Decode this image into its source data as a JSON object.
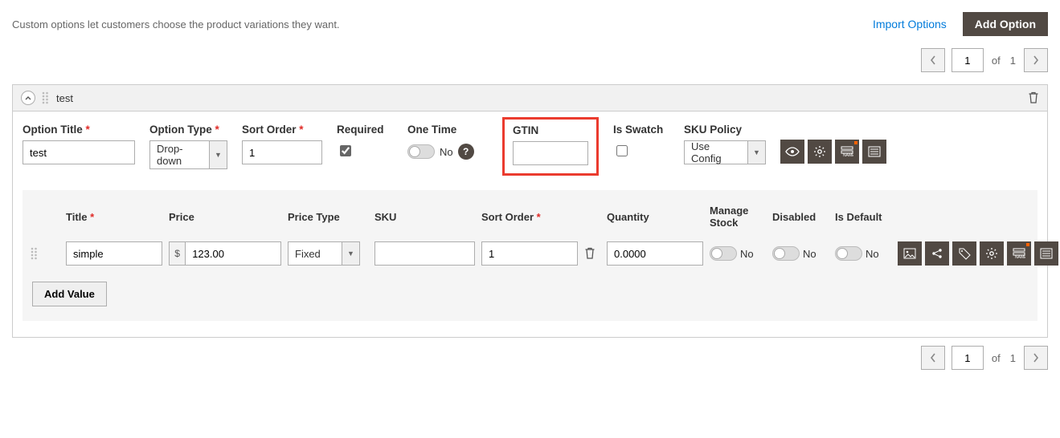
{
  "description": "Custom options let customers choose the product variations they want.",
  "top_buttons": {
    "import": "Import Options",
    "add": "Add Option"
  },
  "pager": {
    "current": "1",
    "of_text": "of",
    "total": "1"
  },
  "option": {
    "header_title": "test",
    "fields": {
      "option_title": {
        "label": "Option Title",
        "value": "test"
      },
      "option_type": {
        "label": "Option Type",
        "value": "Drop-down"
      },
      "sort_order": {
        "label": "Sort Order",
        "value": "1"
      },
      "required": {
        "label": "Required",
        "checked": true
      },
      "one_time": {
        "label": "One Time",
        "value_text": "No"
      },
      "gtin": {
        "label": "GTIN",
        "value": ""
      },
      "is_swatch": {
        "label": "Is Swatch",
        "checked": false
      },
      "sku_policy": {
        "label": "SKU Policy",
        "value": "Use Config"
      }
    },
    "value_headers": {
      "title": "Title",
      "price": "Price",
      "price_type": "Price Type",
      "sku": "SKU",
      "sort_order": "Sort Order",
      "quantity": "Quantity",
      "manage_stock": "Manage Stock",
      "disabled": "Disabled",
      "is_default": "Is Default"
    },
    "value_row": {
      "title": "simple",
      "price_currency": "$",
      "price": "123.00",
      "price_type": "Fixed",
      "sku": "",
      "sort_order": "1",
      "quantity": "0.0000",
      "manage_stock_text": "No",
      "disabled_text": "No",
      "is_default_text": "No"
    },
    "add_value_label": "Add Value"
  },
  "icons": {
    "eye": "eye",
    "gear": "gear",
    "rows": "rows",
    "list": "list",
    "image": "image",
    "share": "share",
    "tag": "tag",
    "name": "name"
  }
}
